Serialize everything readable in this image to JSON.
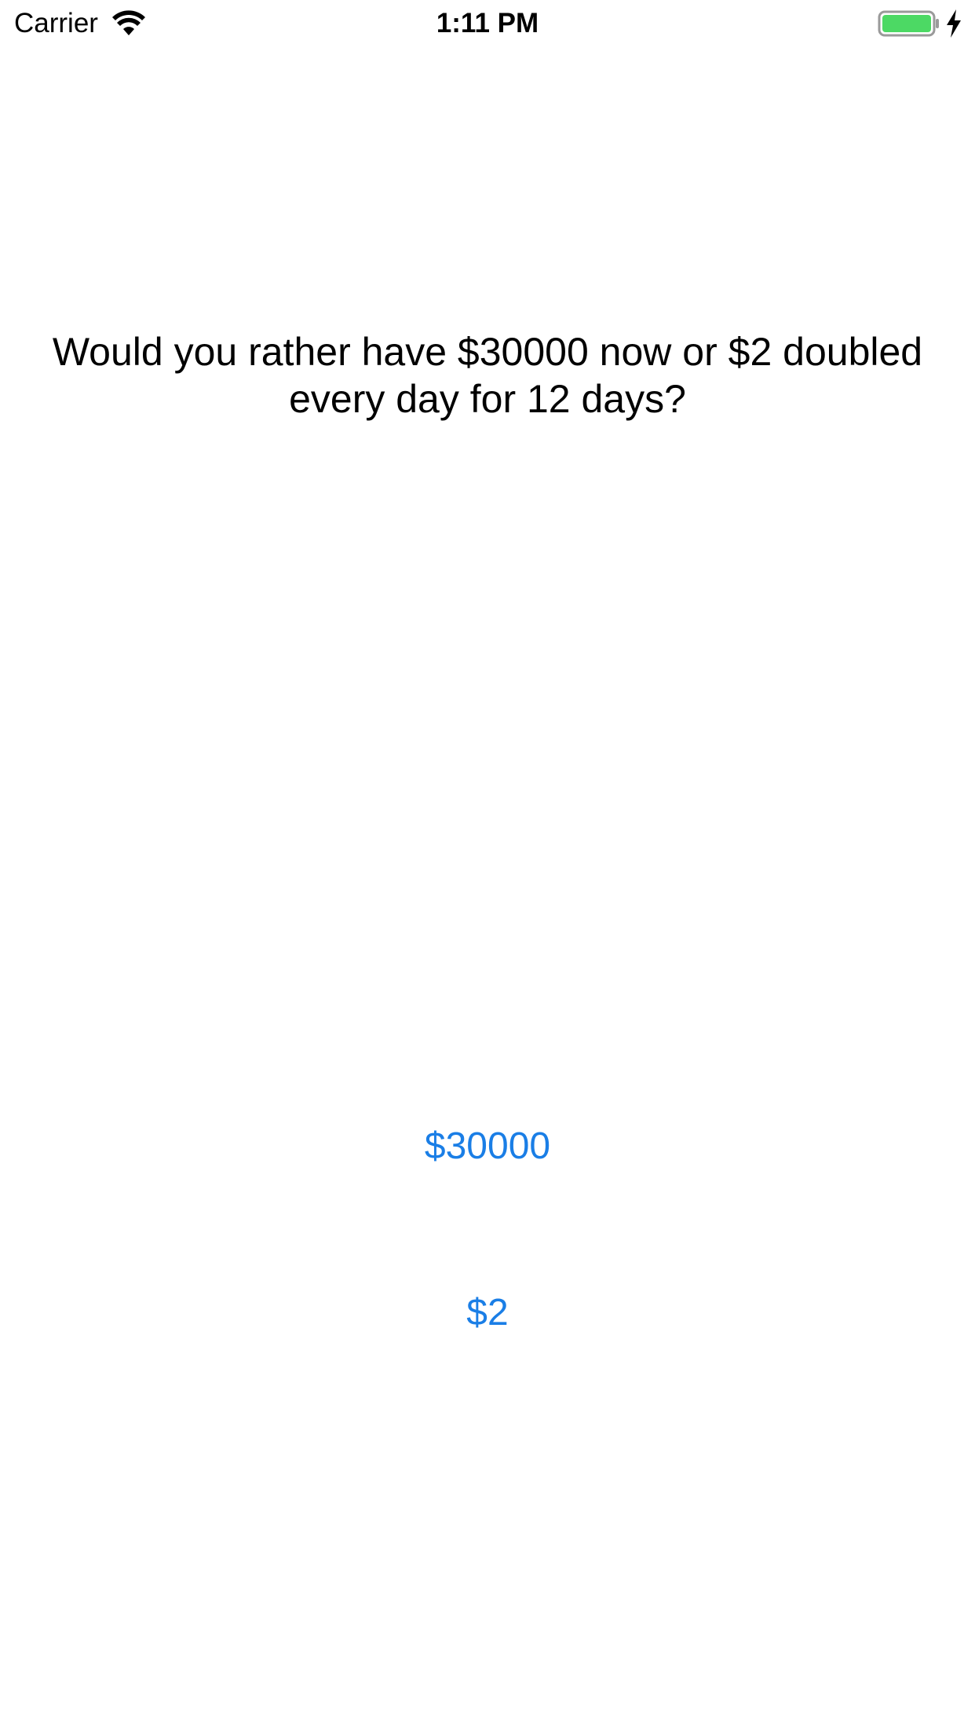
{
  "status_bar": {
    "carrier": "Carrier",
    "time": "1:11 PM",
    "battery_color": "#4cd964",
    "icons": [
      "wifi-icon",
      "battery-icon",
      "charging-bolt-icon"
    ]
  },
  "main": {
    "question": "Would you rather have $30000 now or $2 doubled every day for 12 days?",
    "option_1_label": "$30000",
    "option_2_label": "$2",
    "accent_color": "#1a7ee6"
  }
}
